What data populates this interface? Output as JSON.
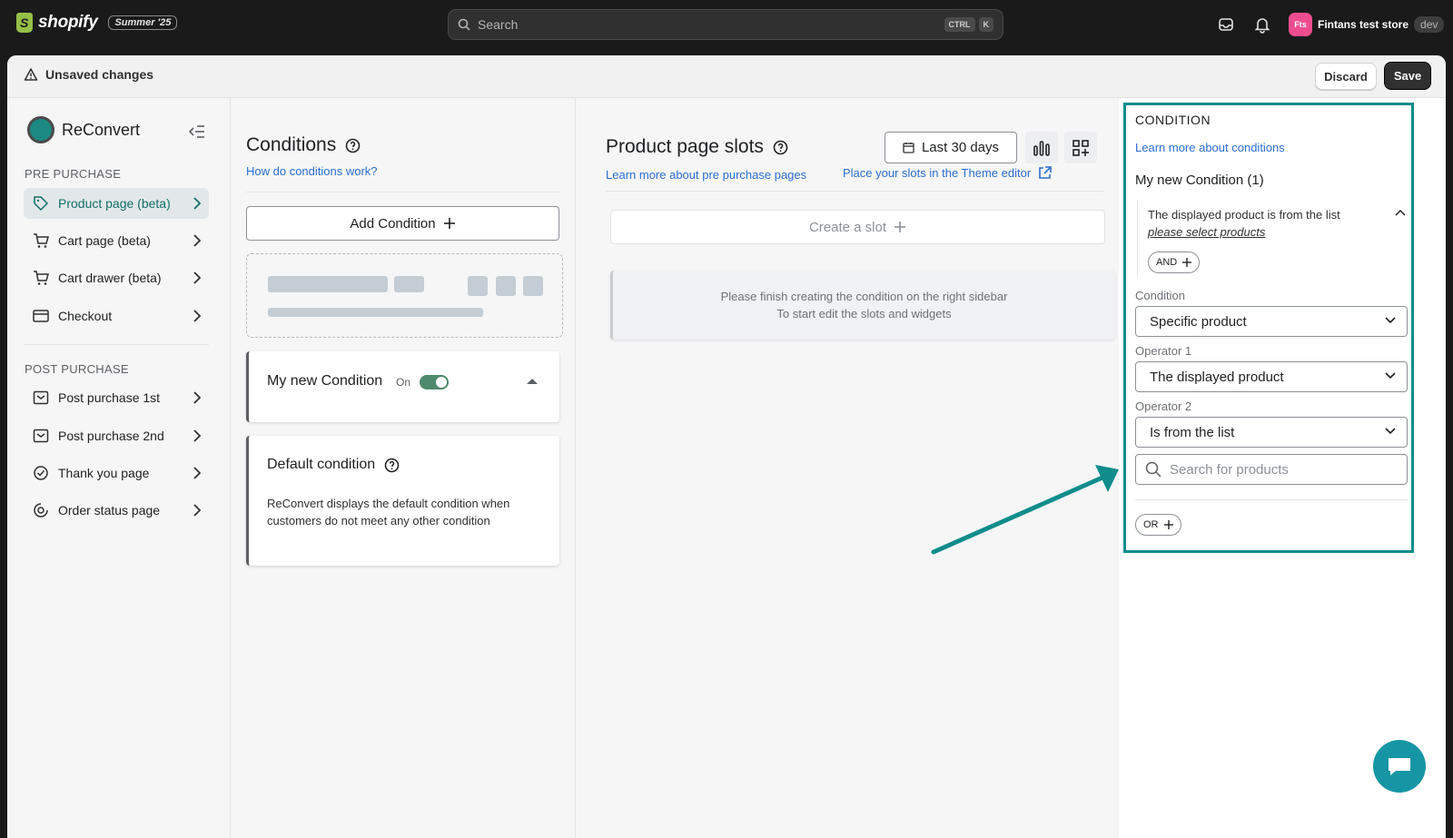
{
  "topbar": {
    "brand": "shopify",
    "edition": "Summer '25",
    "search_placeholder": "Search",
    "kbd1": "CTRL",
    "kbd2": "K",
    "store_initials": "Fts",
    "store_name": "Fintans test store",
    "store_badge": "dev"
  },
  "savebar": {
    "message": "Unsaved changes",
    "discard": "Discard",
    "save": "Save"
  },
  "sidebar": {
    "app_name": "ReConvert",
    "pre_label": "PRE PURCHASE",
    "post_label": "POST PURCHASE",
    "pre_items": [
      {
        "label": "Product page (beta)",
        "icon": "tag-icon"
      },
      {
        "label": "Cart page (beta)",
        "icon": "cart-icon"
      },
      {
        "label": "Cart drawer (beta)",
        "icon": "cart-icon"
      },
      {
        "label": "Checkout",
        "icon": "card-icon"
      }
    ],
    "post_items": [
      {
        "label": "Post purchase 1st",
        "icon": "page-icon"
      },
      {
        "label": "Post purchase 2nd",
        "icon": "page-icon"
      },
      {
        "label": "Thank you page",
        "icon": "badge-check-icon"
      },
      {
        "label": "Order status page",
        "icon": "status-icon"
      }
    ]
  },
  "conditions": {
    "title": "Conditions",
    "help_link": "How do conditions work?",
    "add_button": "Add Condition",
    "item_title": "My new Condition",
    "item_status": "On",
    "default_title": "Default condition",
    "default_desc": "ReConvert displays the default condition when customers do not meet any other condition"
  },
  "slots": {
    "title": "Product page slots",
    "date_range": "Last 30 days",
    "link_learn": "Learn more about pre purchase pages",
    "link_theme": "Place your slots in the Theme editor",
    "create_slot": "Create a slot",
    "notice_line1": "Please finish creating the condition on the right sidebar",
    "notice_line2": "To start edit the slots and widgets"
  },
  "panel": {
    "heading": "CONDITION",
    "learn_link": "Learn more about conditions",
    "name": "My new Condition (1)",
    "rule_text": "The displayed product is from the list",
    "rule_link": "please select products",
    "and_label": "AND",
    "condition_label": "Condition",
    "condition_value": "Specific product",
    "op1_label": "Operator 1",
    "op1_value": "The displayed product",
    "op2_label": "Operator 2",
    "op2_value": "Is from the list",
    "search_placeholder": "Search for products",
    "or_label": "OR"
  },
  "colors": {
    "accent": "#108c8c",
    "link": "#2c6ecb",
    "toggle_on": "#4f8a6c"
  }
}
